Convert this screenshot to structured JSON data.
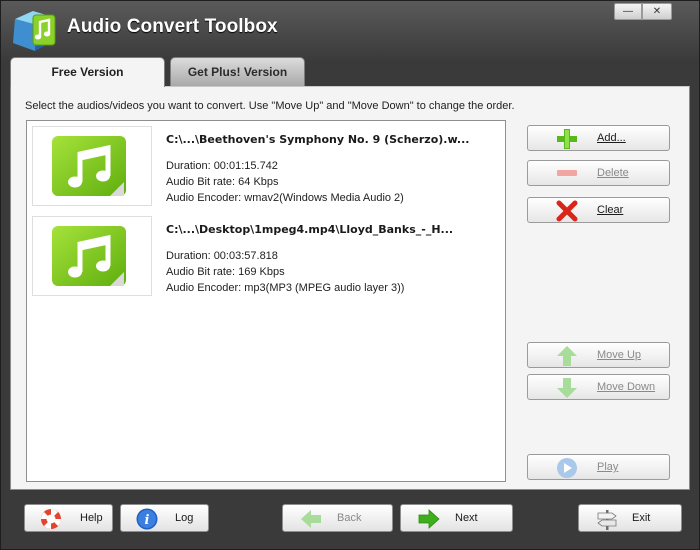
{
  "window": {
    "title": "Audio Convert Toolbox",
    "minimize_glyph": "—",
    "close_glyph": "✕"
  },
  "tabs": [
    {
      "label": "Free Version",
      "active": true
    },
    {
      "label": "Get Plus! Version",
      "active": false
    }
  ],
  "instruction": "Select the audios/videos you want to convert. Use \"Move Up\" and \"Move Down\" to change the order.",
  "files": [
    {
      "name": "C:\\...\\Beethoven's Symphony No. 9 (Scherzo).w...",
      "duration": "Duration: 00:01:15.742",
      "bitrate": "Audio Bit rate: 64 Kbps",
      "encoder": "Audio Encoder: wmav2(Windows Media Audio 2)"
    },
    {
      "name": "C:\\...\\Desktop\\1mpeg4.mp4\\Lloyd_Banks_-_H...",
      "duration": "Duration: 00:03:57.818",
      "bitrate": "Audio Bit rate: 169 Kbps",
      "encoder": "Audio Encoder: mp3(MP3 (MPEG audio layer 3))"
    }
  ],
  "side_buttons": {
    "add": "Add...",
    "delete": "Delete",
    "clear": "Clear",
    "move_up": "Move Up",
    "move_down": "Move Down",
    "play": "Play"
  },
  "bottom_buttons": {
    "help": "Help",
    "log": "Log",
    "back": "Back",
    "next": "Next",
    "exit": "Exit"
  },
  "icons": {
    "app": "music-cube-icon",
    "file_thumb": "music-note-icon",
    "add": "plus-icon",
    "delete": "minus-icon",
    "clear": "red-x-icon",
    "move_up": "up-arrow-icon",
    "move_down": "down-arrow-icon",
    "play": "play-icon",
    "help": "lifebuoy-icon",
    "log": "info-icon",
    "back": "left-arrow-icon",
    "next": "right-arrow-icon",
    "exit": "signpost-icon"
  },
  "colors": {
    "accent_green": "#7cc61e",
    "clear_red": "#d8261b",
    "info_blue": "#1f5fbf",
    "titlebar": "#3a3a3a"
  }
}
